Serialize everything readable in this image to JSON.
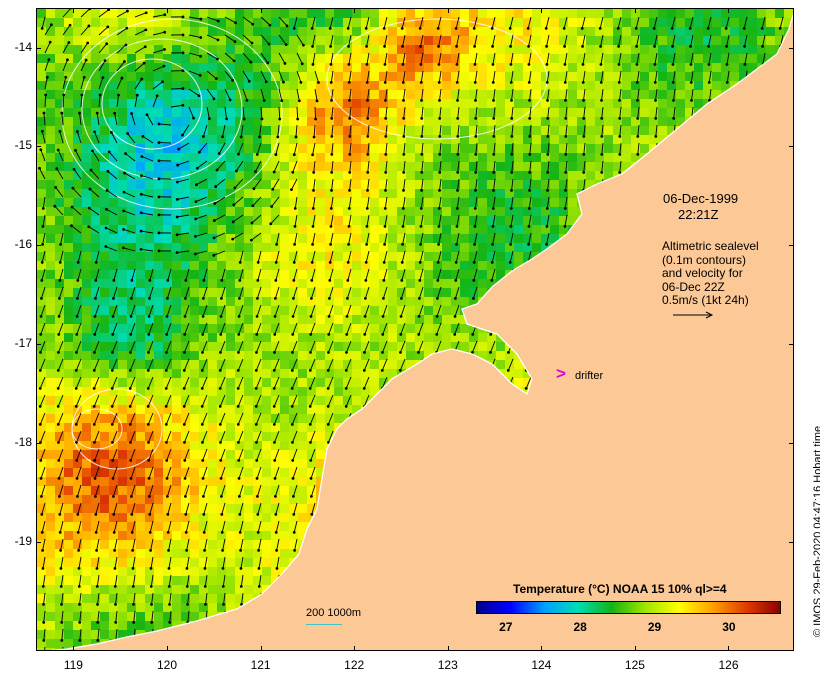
{
  "map": {
    "lon_ticks": [
      "119",
      "120",
      "121",
      "122",
      "123",
      "124",
      "125",
      "126"
    ],
    "lat_ticks": [
      "-14",
      "-15",
      "-16",
      "-17",
      "-18",
      "-19"
    ],
    "lon_range": [
      118.6,
      126.7
    ],
    "lat_range": [
      -13.6,
      -20.1
    ],
    "land_color": "#fbc896",
    "coast_color": "#ffffff"
  },
  "annotation": {
    "date": "06-Dec-1999",
    "time": "22:21Z",
    "altimetric_lines": [
      "Altimetric sealevel",
      "(0.1m contours)",
      "and velocity for",
      "06-Dec 22Z",
      "0.5m/s (1kt 24h)"
    ]
  },
  "drifter": {
    "marker": ">",
    "label": "drifter",
    "color": "#e000e0"
  },
  "bathymetry": {
    "label": "200  1000m",
    "color": "#3cc6c6"
  },
  "colorbar": {
    "title": "Temperature (°C) NOAA 15 10% ql>=4",
    "ticks": [
      "27",
      "28",
      "29",
      "30"
    ],
    "range": [
      26.6,
      30.7
    ],
    "colors": [
      "#00008c",
      "#0000ff",
      "#00a0ff",
      "#00dcb4",
      "#14b414",
      "#a0e600",
      "#ffff00",
      "#ffa000",
      "#e03c00",
      "#8c0000"
    ]
  },
  "credit": "© IMOS 29-Feb-2020 04:47:16 Hobart time"
}
